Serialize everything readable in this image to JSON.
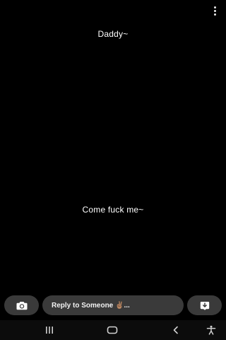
{
  "story": {
    "caption_top": "Daddy~",
    "caption_middle": "Come fuck me~"
  },
  "top_bar": {
    "more_icon": "more-vertical-icon"
  },
  "reply_bar": {
    "camera_icon": "camera-icon",
    "placeholder": "Reply to Someone ✌🏽...",
    "download_icon": "download-icon"
  },
  "nav_bar": {
    "items": [
      "recent-apps-icon",
      "home-icon",
      "back-icon",
      "accessibility-icon"
    ]
  },
  "colors": {
    "background": "#000000",
    "pill": "#3a3a3a",
    "text": "#ffffff"
  }
}
